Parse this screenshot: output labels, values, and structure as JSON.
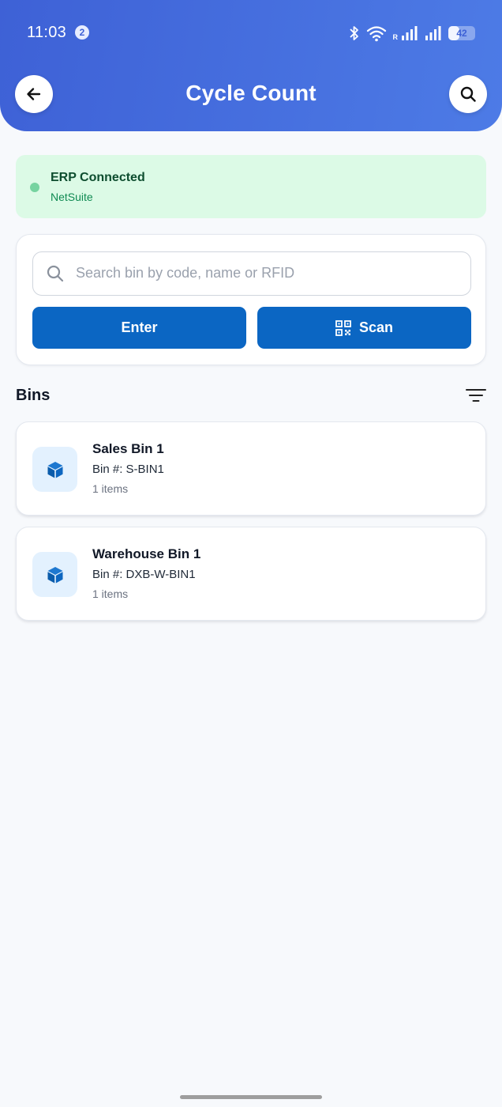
{
  "status_bar": {
    "time": "11:03",
    "notification_count": "2",
    "roaming_label": "R",
    "battery_level": "42",
    "battery_fraction": 0.42
  },
  "header": {
    "title": "Cycle Count",
    "back_icon": "arrow-left-icon",
    "search_icon": "search-icon",
    "gradient_start": "#3e61d6",
    "gradient_end": "#4d7be6"
  },
  "erp_status": {
    "title": "ERP Connected",
    "system": "NetSuite",
    "status_color": "#76d3a0",
    "background": "#dcfae6"
  },
  "search": {
    "placeholder": "Search bin by code, name or RFID",
    "value": "",
    "enter_label": "Enter",
    "scan_label": "Scan",
    "button_color": "#0b66c3"
  },
  "bins": {
    "heading": "Bins",
    "filter_icon": "filter-icon",
    "items": [
      {
        "name": "Sales Bin 1",
        "code": "Bin #: S-BIN1",
        "items": "1 items",
        "icon": "cube-icon"
      },
      {
        "name": "Warehouse Bin 1",
        "code": "Bin #: DXB-W-BIN1",
        "items": "1 items",
        "icon": "cube-icon"
      }
    ]
  }
}
